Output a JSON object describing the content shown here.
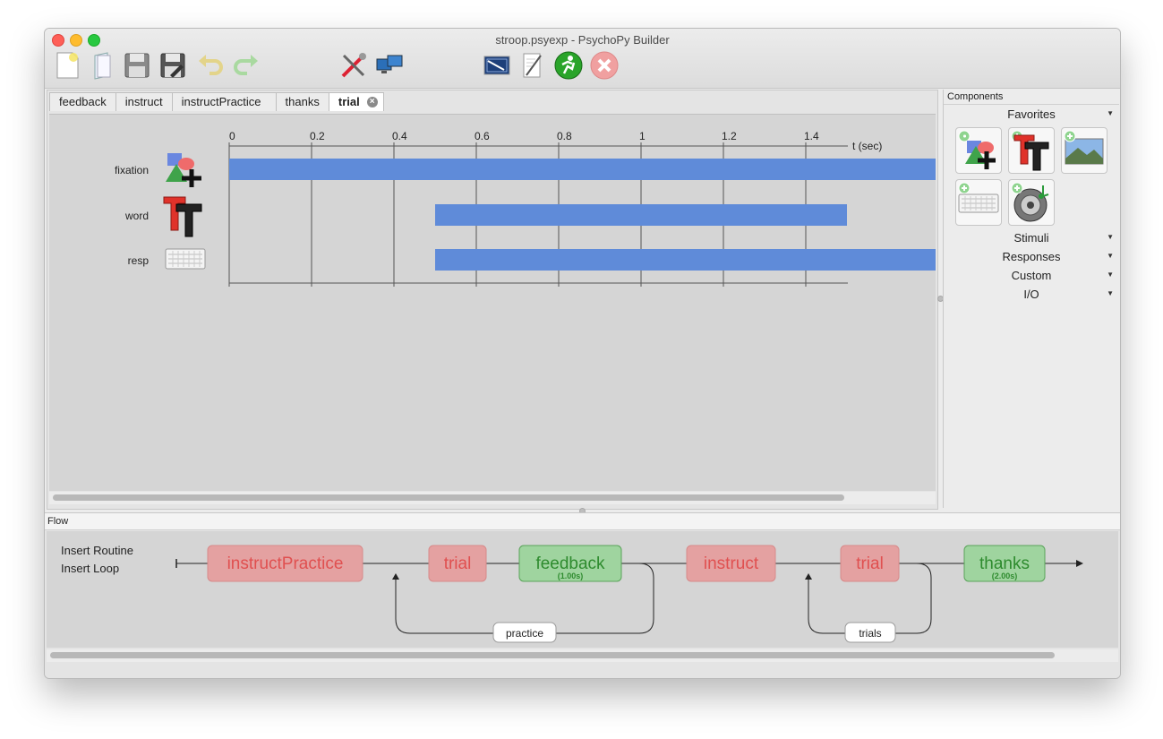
{
  "window": {
    "title": "stroop.psyexp - PsychoPy Builder"
  },
  "toolbar": {
    "icons": [
      "new-file-icon",
      "open-file-icon",
      "save-icon",
      "save-as-icon",
      "undo-icon",
      "redo-icon",
      "preferences-icon",
      "monitor-center-icon",
      "experiment-settings-icon",
      "compile-script-icon",
      "run-icon",
      "stop-icon"
    ]
  },
  "routine_tabs": [
    {
      "label": "feedback",
      "active": false
    },
    {
      "label": "instruct",
      "active": false
    },
    {
      "label": "instructPractice",
      "active": false
    },
    {
      "label": "thanks",
      "active": false
    },
    {
      "label": "trial",
      "active": true
    }
  ],
  "timeline": {
    "axis_label": "t (sec)",
    "ticks": [
      "0",
      "0.2",
      "0.4",
      "0.6",
      "0.8",
      "1",
      "1.2",
      "1.4"
    ],
    "components": [
      {
        "name": "fixation",
        "icon": "polygon-icon",
        "start": 0,
        "end": null
      },
      {
        "name": "word",
        "icon": "text-icon",
        "start": 0.5,
        "end": 1.5
      },
      {
        "name": "resp",
        "icon": "keyboard-icon",
        "start": 0.5,
        "end": null
      }
    ],
    "bar_color": "#5f8bd9"
  },
  "components_panel": {
    "header": "Components",
    "favorites": "Favorites",
    "favorite_icons": [
      "polygon-icon",
      "text-icon",
      "image-icon",
      "keyboard-icon",
      "sound-icon"
    ],
    "categories": [
      "Stimuli",
      "Responses",
      "Custom",
      "I/O"
    ]
  },
  "flow": {
    "header": "Flow",
    "insert_routine": "Insert Routine",
    "insert_loop": "Insert Loop",
    "routines": [
      {
        "label": "instructPractice",
        "kind": "nonslip",
        "duration": ""
      },
      {
        "label": "trial",
        "kind": "nonslip",
        "duration": ""
      },
      {
        "label": "feedback",
        "kind": "timed",
        "duration": "(1.00s)"
      },
      {
        "label": "instruct",
        "kind": "nonslip",
        "duration": ""
      },
      {
        "label": "trial",
        "kind": "nonslip",
        "duration": ""
      },
      {
        "label": "thanks",
        "kind": "timed",
        "duration": "(2.00s)"
      }
    ],
    "loops": [
      "practice",
      "trials"
    ],
    "colors": {
      "nonslip_fill": "#e4a1a1",
      "nonslip_text": "#e05050",
      "timed_fill": "#9fd49f",
      "timed_text": "#2e8b2e"
    }
  }
}
